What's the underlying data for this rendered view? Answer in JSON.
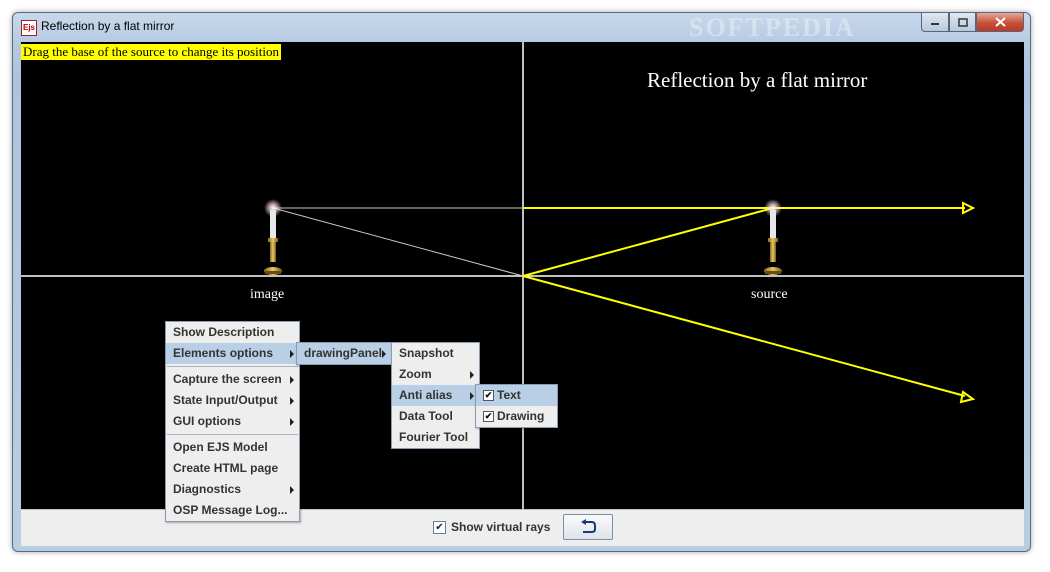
{
  "window": {
    "icon_text": "Ejs",
    "title": "Reflection by a flat mirror",
    "watermark": "SOFTPEDIA"
  },
  "simulation": {
    "hint": "Drag the base of the source to change its position",
    "title": "Reflection by a flat mirror",
    "image_label": "image",
    "source_label": "source",
    "colors": {
      "background": "#000000",
      "axes": "#ffffff",
      "real_rays": "#ffff00",
      "virtual_rays": "#c8c8c8"
    }
  },
  "bottom": {
    "show_virtual_rays_label": "Show virtual rays",
    "show_virtual_rays_checked": true,
    "reset_icon": "undo-arrow-icon"
  },
  "menus": {
    "main": {
      "items": [
        {
          "label": "Show Description"
        },
        {
          "label": "Elements options",
          "submenu": true,
          "selected": true
        },
        {
          "separator": true
        },
        {
          "label": "Capture the screen",
          "submenu": true
        },
        {
          "label": "State Input/Output",
          "submenu": true
        },
        {
          "label": "GUI options",
          "submenu": true
        },
        {
          "separator": true
        },
        {
          "label": "Open EJS Model"
        },
        {
          "label": "Create HTML page"
        },
        {
          "label": "Diagnostics",
          "submenu": true
        },
        {
          "label": "OSP Message Log..."
        }
      ]
    },
    "elements": {
      "items": [
        {
          "label": "drawingPanel",
          "submenu": true,
          "selected": true
        }
      ]
    },
    "drawing_panel": {
      "items": [
        {
          "label": "Snapshot"
        },
        {
          "label": "Zoom",
          "submenu": true
        },
        {
          "label": "Anti alias",
          "submenu": true,
          "selected": true
        },
        {
          "label": "Data Tool"
        },
        {
          "label": "Fourier Tool"
        }
      ]
    },
    "anti_alias": {
      "items": [
        {
          "label": "Text",
          "checked": true,
          "selected": true
        },
        {
          "label": "Drawing",
          "checked": true
        }
      ]
    }
  }
}
